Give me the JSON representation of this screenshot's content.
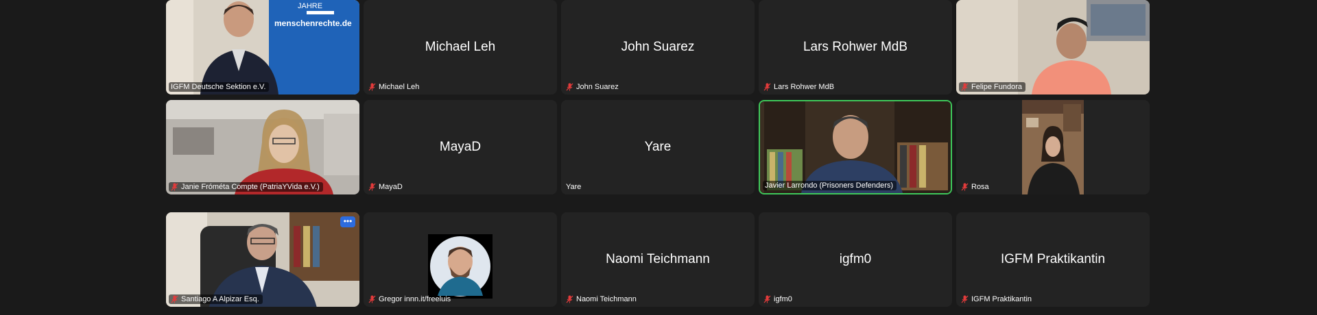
{
  "participants": [
    {
      "name": "IGFM Deutsche Sektion e.V.",
      "display": "video",
      "banner_text": "menschenrechte.de",
      "banner_top": "JAHRE"
    },
    {
      "name": "Michael Leh",
      "display": "name"
    },
    {
      "name": "John Suarez",
      "display": "name"
    },
    {
      "name": "Lars Rohwer MdB",
      "display": "name"
    },
    {
      "name": "Felipe Fundora",
      "display": "video"
    },
    {
      "name": "Janie Fróméta Compte (PatriaYVida e.V.)",
      "display": "video"
    },
    {
      "name": "MayaD",
      "display": "name"
    },
    {
      "name": "Yare",
      "display": "name",
      "muted": false
    },
    {
      "name": "Javier Larrondo (Prisoners Defenders)",
      "display": "video",
      "active_speaker": true
    },
    {
      "name": "Rosa",
      "display": "video"
    },
    {
      "name": "Santiago A Alpizar Esq.",
      "display": "video",
      "more_button": "•••"
    },
    {
      "name": "Gregor innn.it/freeluis",
      "display": "avatar"
    },
    {
      "name": "Naomi Teichmann",
      "display": "name"
    },
    {
      "name": "igfm0",
      "display": "name"
    },
    {
      "name": "IGFM Praktikantin",
      "display": "name"
    }
  ],
  "colors": {
    "background": "#1a1a1a",
    "tile": "#232323",
    "active_border": "#3ec85a",
    "muted_icon": "#e23b3b"
  },
  "icons": {
    "muted": "mic-muted-icon",
    "more": "more-options-icon"
  }
}
